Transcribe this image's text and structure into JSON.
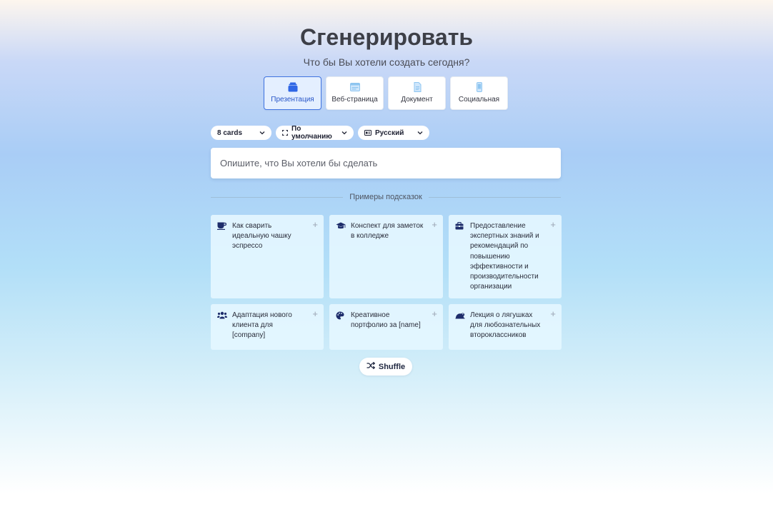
{
  "header": {
    "title": "Сгенерировать",
    "subtitle": "Что бы Вы хотели создать сегодня?"
  },
  "content_types": [
    {
      "label": "Презентация",
      "icon": "presentation-icon",
      "active": true
    },
    {
      "label": "Веб-страница",
      "icon": "webpage-icon",
      "active": false
    },
    {
      "label": "Документ",
      "icon": "document-icon",
      "active": false
    },
    {
      "label": "Социальная",
      "icon": "social-icon",
      "active": false
    }
  ],
  "options": {
    "cards": {
      "value": "8 cards"
    },
    "format": {
      "value": "По умолчанию",
      "icon": "aspect-ratio-icon"
    },
    "language": {
      "value": "Русский",
      "icon": "language-icon"
    }
  },
  "prompt": {
    "placeholder": "Опишите, что Вы хотели бы сделать",
    "value": ""
  },
  "examples": {
    "heading": "Примеры подсказок",
    "items": [
      {
        "text": "Как сварить идеальную чашку эспрессо",
        "icon": "coffee-icon"
      },
      {
        "text": "Конспект для заметок в колледже",
        "icon": "graduation-cap-icon"
      },
      {
        "text": "Предоставление экспертных знаний и рекомендаций по повышению эффективности и производительности организации",
        "icon": "briefcase-icon"
      },
      {
        "text": "Адаптация нового клиента для [company]",
        "icon": "users-icon"
      },
      {
        "text": "Креативное портфолио за [name]",
        "icon": "palette-icon"
      },
      {
        "text": "Лекция о лягушках для любознательных второклассников",
        "icon": "frog-icon"
      }
    ],
    "add_symbol": "+"
  },
  "shuffle": {
    "label": "Shuffle",
    "icon": "shuffle-icon"
  },
  "colors": {
    "accent": "#3f73e0",
    "icon_dark": "#1e2d6b",
    "icon_light": "#8ec5f0"
  }
}
